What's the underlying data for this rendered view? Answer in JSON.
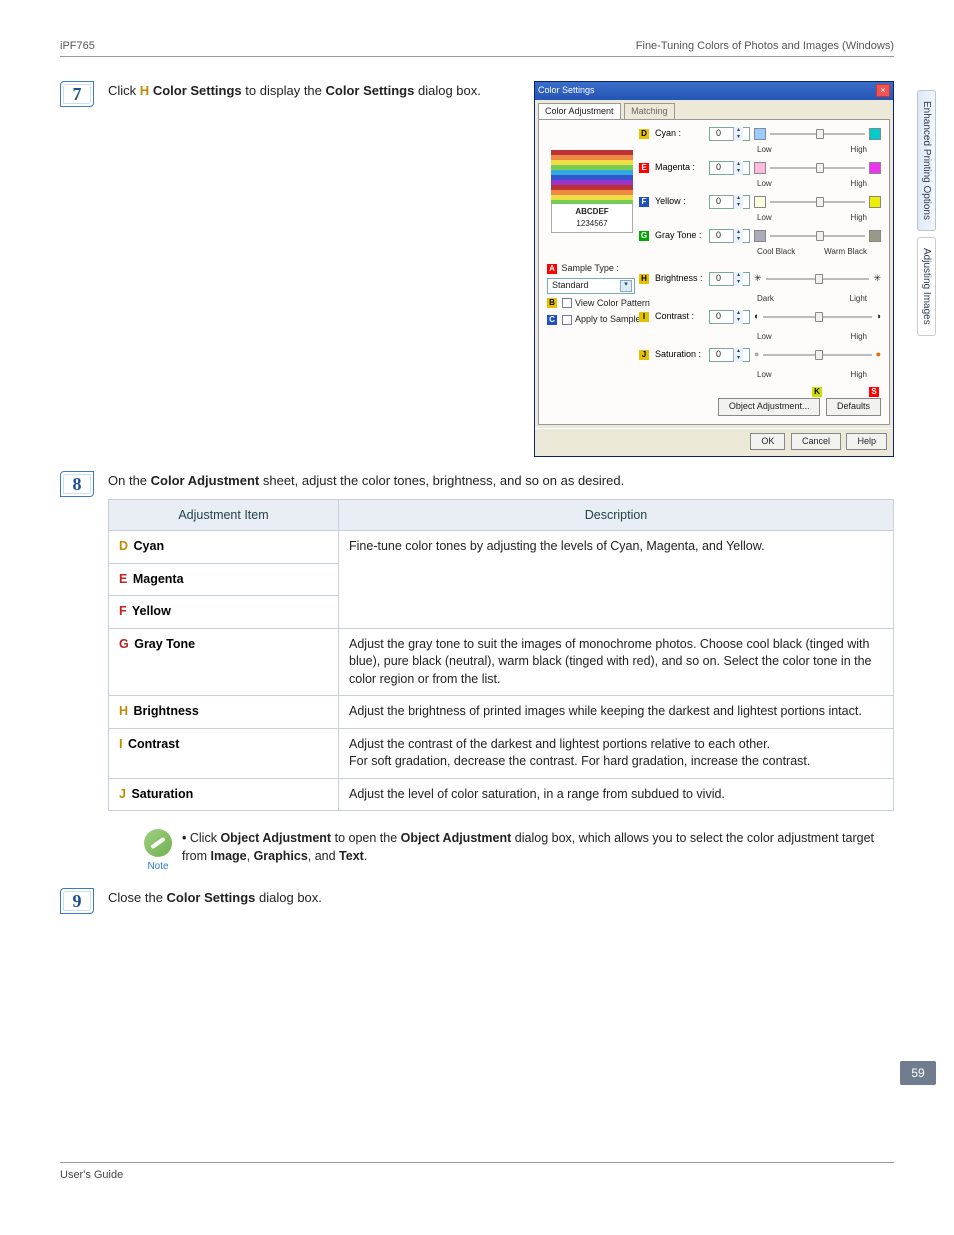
{
  "header": {
    "left": "iPF765",
    "right": "Fine-Tuning Colors of Photos and Images (Windows)"
  },
  "sideTabs": {
    "a": "Enhanced Printing Options",
    "b": "Adjusting Images"
  },
  "step7": {
    "pre": "Click",
    "refLetter": "H",
    "refName": "Color Settings",
    "mid": "to display the",
    "target": "Color Settings",
    "post": "dialog box."
  },
  "dialog": {
    "title": "Color Settings",
    "tabs": {
      "active": "Color Adjustment",
      "inactive": "Matching"
    },
    "sampleText1": "ABCDEF",
    "sampleText2": "1234567",
    "rows": {
      "cyan": {
        "m": "D",
        "label": "Cyan :",
        "val": "0",
        "lo": "Low",
        "hi": "High"
      },
      "mag": {
        "m": "E",
        "label": "Magenta :",
        "val": "0",
        "lo": "Low",
        "hi": "High"
      },
      "yel": {
        "m": "F",
        "label": "Yellow :",
        "val": "0",
        "lo": "Low",
        "hi": "High"
      },
      "gray": {
        "m": "G",
        "label": "Gray Tone :",
        "val": "0",
        "lo": "Cool Black",
        "hi": "Warm Black"
      },
      "bri": {
        "m": "H",
        "label": "Brightness :",
        "val": "0",
        "lo": "Dark",
        "hi": "Light"
      },
      "con": {
        "m": "I",
        "label": "Contrast :",
        "val": "0",
        "lo": "Low",
        "hi": "High"
      },
      "sat": {
        "m": "J",
        "label": "Saturation :",
        "val": "0",
        "lo": "Low",
        "hi": "High"
      }
    },
    "sampleTypeLabel": "Sample Type :",
    "sampleTypeMarker": "A",
    "sampleTypeValue": "Standard",
    "viewPattern": {
      "m": "B",
      "label": "View Color Pattern"
    },
    "applySample": {
      "m": "C",
      "label": "Apply to Sample"
    },
    "footer": {
      "k": "K",
      "s": "S",
      "obj": "Object Adjustment...",
      "def": "Defaults",
      "ok": "OK",
      "cancel": "Cancel",
      "help": "Help"
    }
  },
  "step8": {
    "intro_a": "On the",
    "intro_b": "Color Adjustment",
    "intro_c": "sheet, adjust the color tones, brightness, and so on as desired."
  },
  "table": {
    "h1": "Adjustment Item",
    "h2": "Description",
    "rows": [
      {
        "l": "D",
        "cls": "d",
        "name": "Cyan",
        "desc": "Fine-tune color tones by adjusting the levels of Cyan, Magenta, and Yellow.",
        "span": 3
      },
      {
        "l": "E",
        "cls": "e",
        "name": "Magenta"
      },
      {
        "l": "F",
        "cls": "f",
        "name": "Yellow"
      },
      {
        "l": "G",
        "cls": "g",
        "name": "Gray Tone",
        "desc": "Adjust the gray tone to suit the images of monochrome photos. Choose cool black (tinged with blue), pure black (neutral), warm black (tinged with red), and so on. Select the color tone in the color region or from the list."
      },
      {
        "l": "H",
        "cls": "h",
        "name": "Brightness",
        "desc": "Adjust the brightness of printed images while keeping the darkest and lightest portions intact."
      },
      {
        "l": "I",
        "cls": "i",
        "name": "Contrast",
        "desc": "Adjust the contrast of the darkest and lightest portions relative to each other.\nFor soft gradation, decrease the contrast. For hard gradation, increase the contrast."
      },
      {
        "l": "J",
        "cls": "j",
        "name": "Saturation",
        "desc": "Adjust the level of color saturation, in a range from subdued to vivid."
      }
    ]
  },
  "note": {
    "label": "Note",
    "text_a": "Click",
    "text_b": "Object Adjustment",
    "text_c": "to open the",
    "text_d": "Object Adjustment",
    "text_e": "dialog box, which allows you to select the color adjustment target from",
    "text_f": "Image",
    "text_g": "Graphics",
    "text_h": "Text"
  },
  "step9": {
    "a": "Close the",
    "b": "Color Settings",
    "c": "dialog box."
  },
  "pageNum": "59",
  "footer": "User's Guide"
}
